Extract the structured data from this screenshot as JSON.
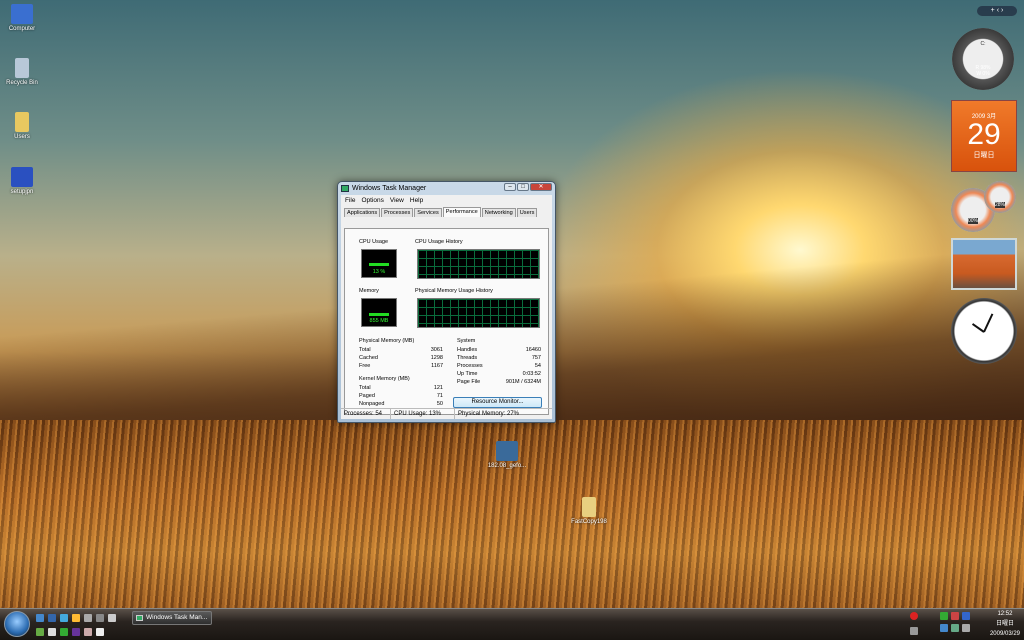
{
  "desktop_icons": [
    {
      "label": "Computer",
      "color": "#3a6fd0"
    },
    {
      "label": "Recycle Bin",
      "color": "#b8c8d8"
    },
    {
      "label": "Users",
      "color": "#e8c860"
    },
    {
      "label": "setupjpn",
      "color": "#2a50c0"
    },
    {
      "label": "182.08_gefo...",
      "color": "#3a6a9a"
    },
    {
      "label": "FastCopy198",
      "color": "#e8d080"
    }
  ],
  "window": {
    "title": "Windows Task Manager",
    "menu": [
      "File",
      "Options",
      "View",
      "Help"
    ],
    "tabs": [
      "Applications",
      "Processes",
      "Services",
      "Performance",
      "Networking",
      "Users"
    ],
    "active_tab": "Performance",
    "cpu_label": "CPU Usage",
    "cpu_value": "13 %",
    "cpu_history_label": "CPU Usage History",
    "mem_label": "Memory",
    "mem_value": "855 MB",
    "mem_history_label": "Physical Memory Usage History",
    "physical": {
      "title": "Physical Memory (MB)",
      "rows": [
        [
          "Total",
          "3061"
        ],
        [
          "Cached",
          "1298"
        ],
        [
          "Free",
          "1167"
        ]
      ]
    },
    "kernel": {
      "title": "Kernel Memory (MB)",
      "rows": [
        [
          "Total",
          "121"
        ],
        [
          "Paged",
          "71"
        ],
        [
          "Nonpaged",
          "50"
        ]
      ]
    },
    "system": {
      "title": "System",
      "rows": [
        [
          "Handles",
          "16460"
        ],
        [
          "Threads",
          "757"
        ],
        [
          "Processes",
          "54"
        ],
        [
          "Up Time",
          "0:03:52"
        ],
        [
          "Page File",
          "901M / 6324M"
        ]
      ]
    },
    "resource_button": "Resource Monitor...",
    "status": [
      "Processes: 54",
      "CPU Usage: 13%",
      "Physical Memory: 27%"
    ]
  },
  "taskbar": {
    "task_button": "Windows Task Man...",
    "time": "12:52",
    "weekday": "日曜日",
    "date": "2009/03/29"
  },
  "gadgets": {
    "cpu_meter": {
      "drive": "C:",
      "r": "R 98%",
      "w": "W 0%"
    },
    "calendar": {
      "month": "2009 3月",
      "day": "29",
      "weekday": "日曜日"
    },
    "meters": {
      "cpu": "00%",
      "mem": "28%"
    }
  }
}
